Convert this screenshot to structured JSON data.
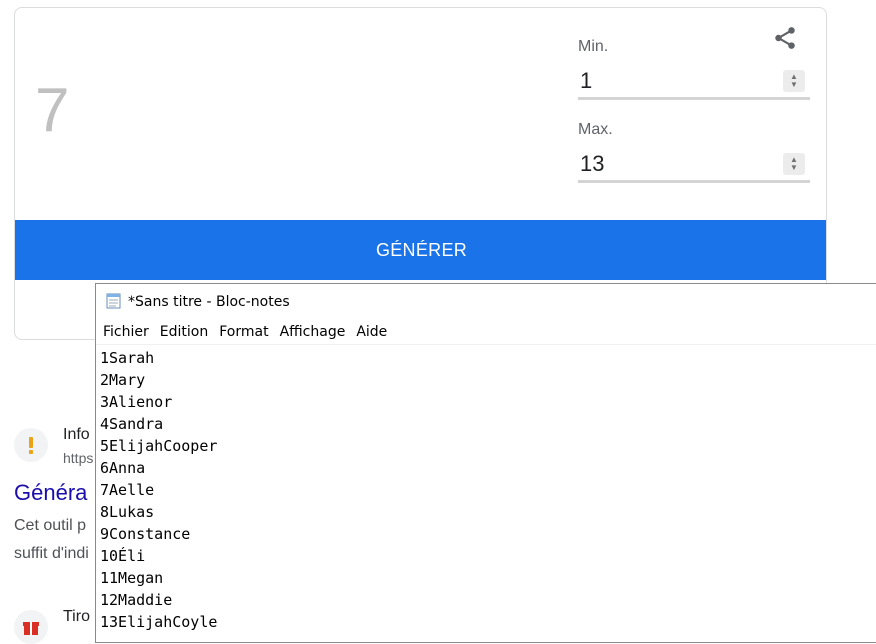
{
  "rng": {
    "result": "7",
    "min_label": "Min.",
    "min_value": "1",
    "max_label": "Max.",
    "max_value": "13",
    "generate_label": "GÉNÉRER"
  },
  "results": {
    "first_title": "Info",
    "first_url": "https",
    "heading": "Généra",
    "snippet_line1": "Cet outil p",
    "snippet_line2": "suffit d'indi",
    "second_title": "Tiro"
  },
  "notepad": {
    "title": "*Sans titre - Bloc-notes",
    "menu": [
      "Fichier",
      "Edition",
      "Format",
      "Affichage",
      "Aide"
    ],
    "lines": [
      "1Sarah",
      "2Mary",
      "3Alienor",
      "4Sandra",
      "5ElijahCooper",
      "6Anna",
      "7Aelle",
      "8Lukas",
      "9Constance",
      "10Éli",
      "11Megan",
      "12Maddie",
      "13ElijahCoyle"
    ]
  },
  "colors": {
    "accent": "#1a73e8",
    "link": "#1a0dab",
    "result_number": "#c0c0c0"
  }
}
